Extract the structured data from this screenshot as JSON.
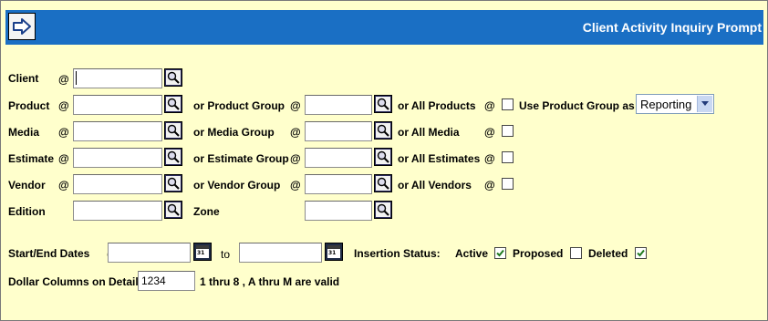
{
  "window": {
    "title": "Client Activity Inquiry Prompt"
  },
  "toolbar": {
    "back_icon": "arrow-right-icon"
  },
  "form": {
    "at_symbol": "@",
    "client": {
      "label": "Client",
      "value": ""
    },
    "product": {
      "label": "Product",
      "value": "",
      "group_label": "or Product Group",
      "group_value": "",
      "all_label": "or All Products",
      "all_checked": false,
      "use_group_label": "Use Product Group as",
      "use_group_selected": "Reporting"
    },
    "media": {
      "label": "Media",
      "value": "",
      "group_label": "or Media Group",
      "group_value": "",
      "all_label": "or All Media",
      "all_checked": false
    },
    "estimate": {
      "label": "Estimate",
      "value": "",
      "group_label": "or Estimate Group",
      "group_value": "",
      "all_label": "or All Estimates",
      "all_checked": false
    },
    "vendor": {
      "label": "Vendor",
      "value": "",
      "group_label": "or Vendor Group",
      "group_value": "",
      "all_label": "or All Vendors",
      "all_checked": false
    },
    "edition": {
      "label": "Edition",
      "value": ""
    },
    "zone": {
      "label": "Zone",
      "value": ""
    },
    "dates": {
      "label": "Start/End Dates",
      "to_label": "to",
      "start_value": "",
      "end_value": ""
    },
    "insertion_status": {
      "label": "Insertion Status:",
      "active_label": "Active",
      "active_checked": true,
      "proposed_label": "Proposed",
      "proposed_checked": false,
      "deleted_label": "Deleted",
      "deleted_checked": true
    },
    "dollar_columns": {
      "label": "Dollar Columns on Detail",
      "value": "1234",
      "hint": "1 thru 8 , A thru M are valid"
    }
  },
  "colors": {
    "background": "#ffffcc",
    "titlebar": "#1a6fc4",
    "title_text": "#ffffff"
  }
}
